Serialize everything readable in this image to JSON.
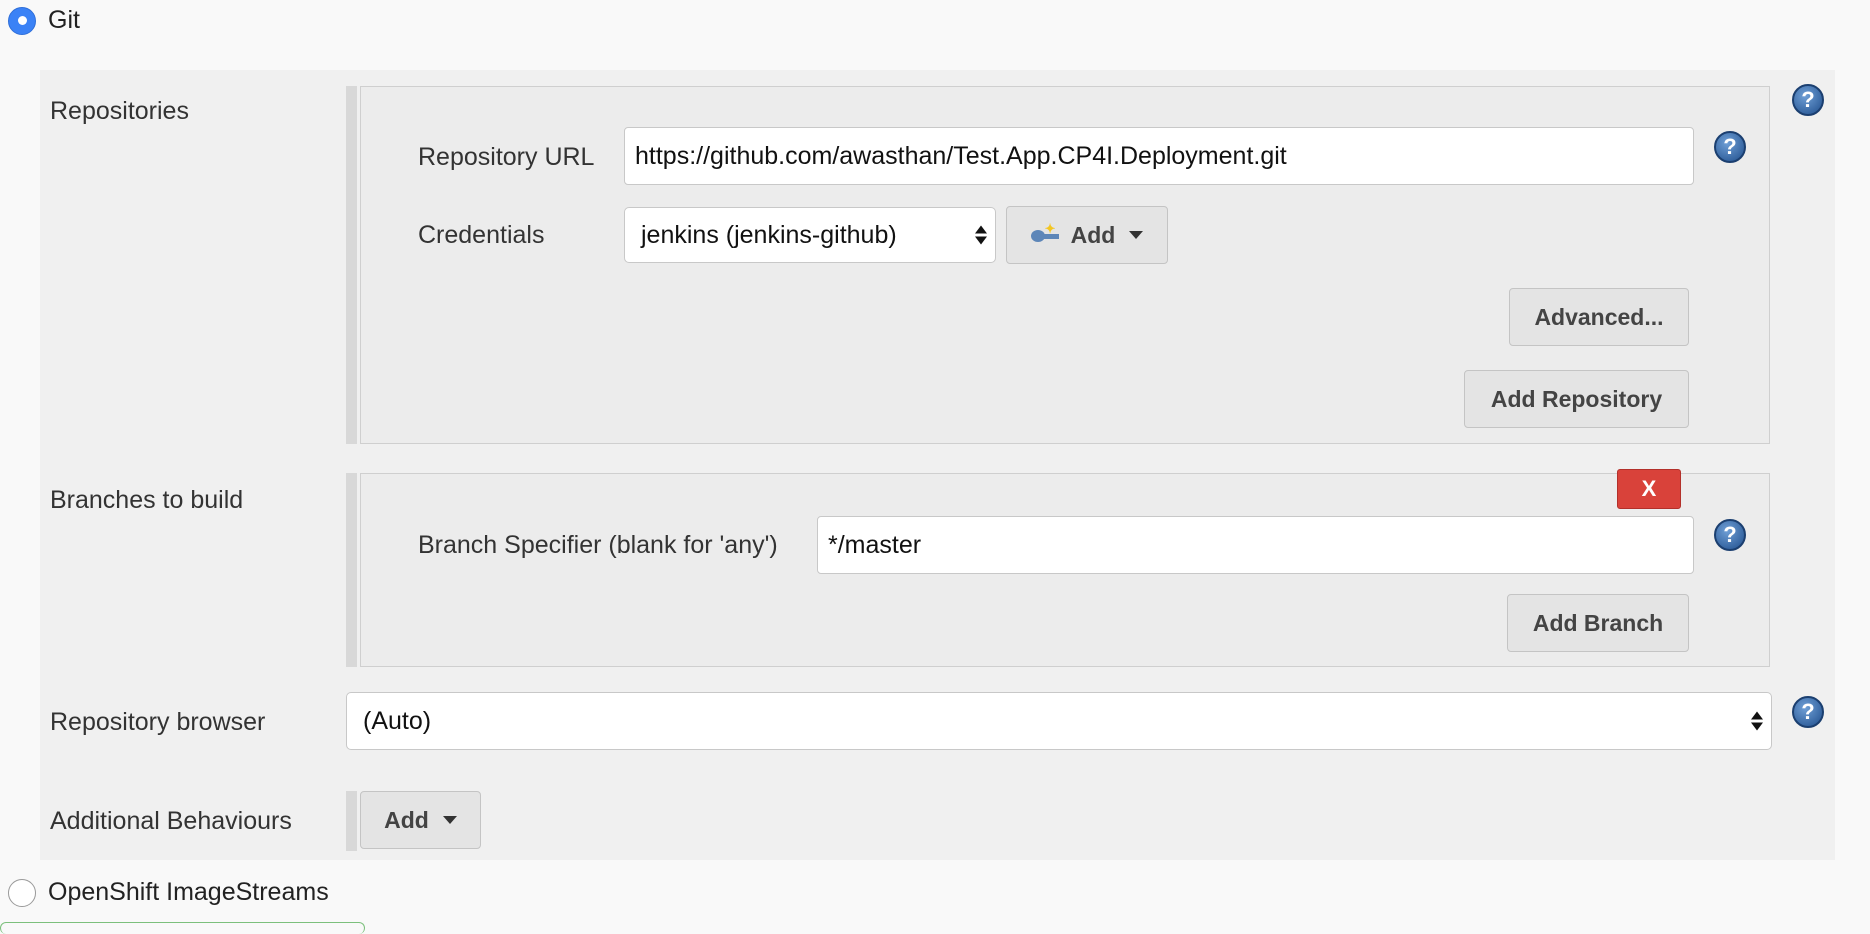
{
  "scm_options": {
    "git_label": "Git",
    "openshift_label": "OpenShift ImageStreams"
  },
  "repositories": {
    "label": "Repositories",
    "url_label": "Repository URL",
    "url_value": "https://github.com/awasthan/Test.App.CP4I.Deployment.git",
    "credentials_label": "Credentials",
    "credentials_value": "jenkins (jenkins-github)",
    "add_label": "Add",
    "advanced_label": "Advanced...",
    "add_repository_label": "Add Repository"
  },
  "branches": {
    "label": "Branches to build",
    "delete_label": "X",
    "specifier_label": "Branch Specifier (blank for 'any')",
    "specifier_value": "*/master",
    "add_branch_label": "Add Branch"
  },
  "repository_browser": {
    "label": "Repository browser",
    "value": "(Auto)"
  },
  "additional_behaviours": {
    "label": "Additional Behaviours",
    "add_label": "Add"
  },
  "help_glyph": "?",
  "colors": {
    "radio_selected": "#3b82f6",
    "delete_red": "#d9423a",
    "help_blue": "#1f4e8c"
  },
  "icons": [
    "help-icon",
    "key-icon",
    "caret-down-icon",
    "select-arrows-icon"
  ]
}
